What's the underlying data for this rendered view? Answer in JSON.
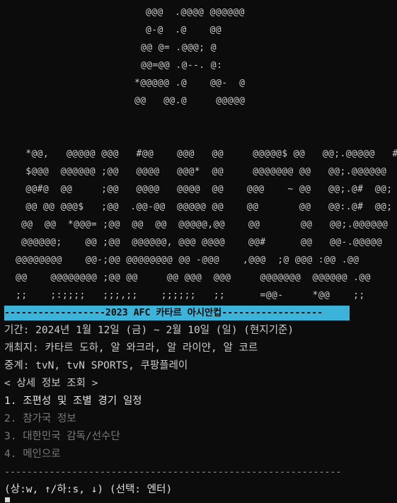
{
  "art": {
    "logo": [
      "@@@  .@@@@ @@@@@@",
      "@-@  .@    @@",
      "@@ @= .@@@; @",
      "@@=@@ .@--. @:",
      "*@@@@@ .@    @@-  @",
      "@@   @@.@     @@@@@"
    ],
    "title": [
      " *@@,   @@@@@ @@@   #@@    @@@   @@     @@@@@$ @@   @@;.@@@@@   #",
      " $@@@  @@@@@@ ;@@   @@@@   @@@*  @@     @@@@@@@ @@   @@;.@@@@@@",
      " @@#@  @@     ;@@   @@@@   @@@@  @@    @@@    ~ @@   @@;.@#  @@;",
      " @@ @@ @@@$   ;@@  .@@-@@  @@@@@ @@    @@       @@   @@:.@#  @@;",
      "@@  @@  *@@@= ;@@  @@  @@  @@@@@,@@    @@       @@   @@;.@@@@@@",
      "@@@@@@;    @@ ;@@  @@@@@@, @@@ @@@@    @@#      @@   @@-.@@@@@",
      "@@@@@@@@    @@-;@@ @@@@@@@@ @@ -@@@    ,@@@  ;@ @@@ :@@ .@@",
      "@@    @@@@@@@@ ;@@ @@     @@ @@@  @@@     @@@@@@@  @@@@@@ .@@",
      ";;    ;:;;;;   ;;;,;;    ;;;;;;   ;;      =@@-     *@@    ;;"
    ]
  },
  "banner": "------------------2023 AFC 카타르 아시안컵------------------",
  "info": {
    "period": "기간: 2024년 1월 12일 (금) ~ 2월 10일 (일) (현지기준)",
    "venue": "개최지: 카타르 도하, 알 와크라, 알 라이얀, 알 코르",
    "broadcast": "중계: tvN, tvN SPORTS, 쿠팡플레이"
  },
  "menu": {
    "header": "< 상세 정보 조회 >",
    "items": [
      "1. 조편성 및 조별 경기 일정",
      "2. 참가국 정보",
      "3. 대한민국 감독/선수단",
      "4. 메인으로"
    ],
    "selected_index": 0
  },
  "divider": "------------------------------------------------------------",
  "prompt": "(상:w, ↑/하:s, ↓) (선택: 엔터)",
  "colors": {
    "background": "#0c0c0c",
    "text": "#cccccc",
    "banner_bg": "#3cb3d9",
    "dim_text": "#7a7a7a"
  }
}
